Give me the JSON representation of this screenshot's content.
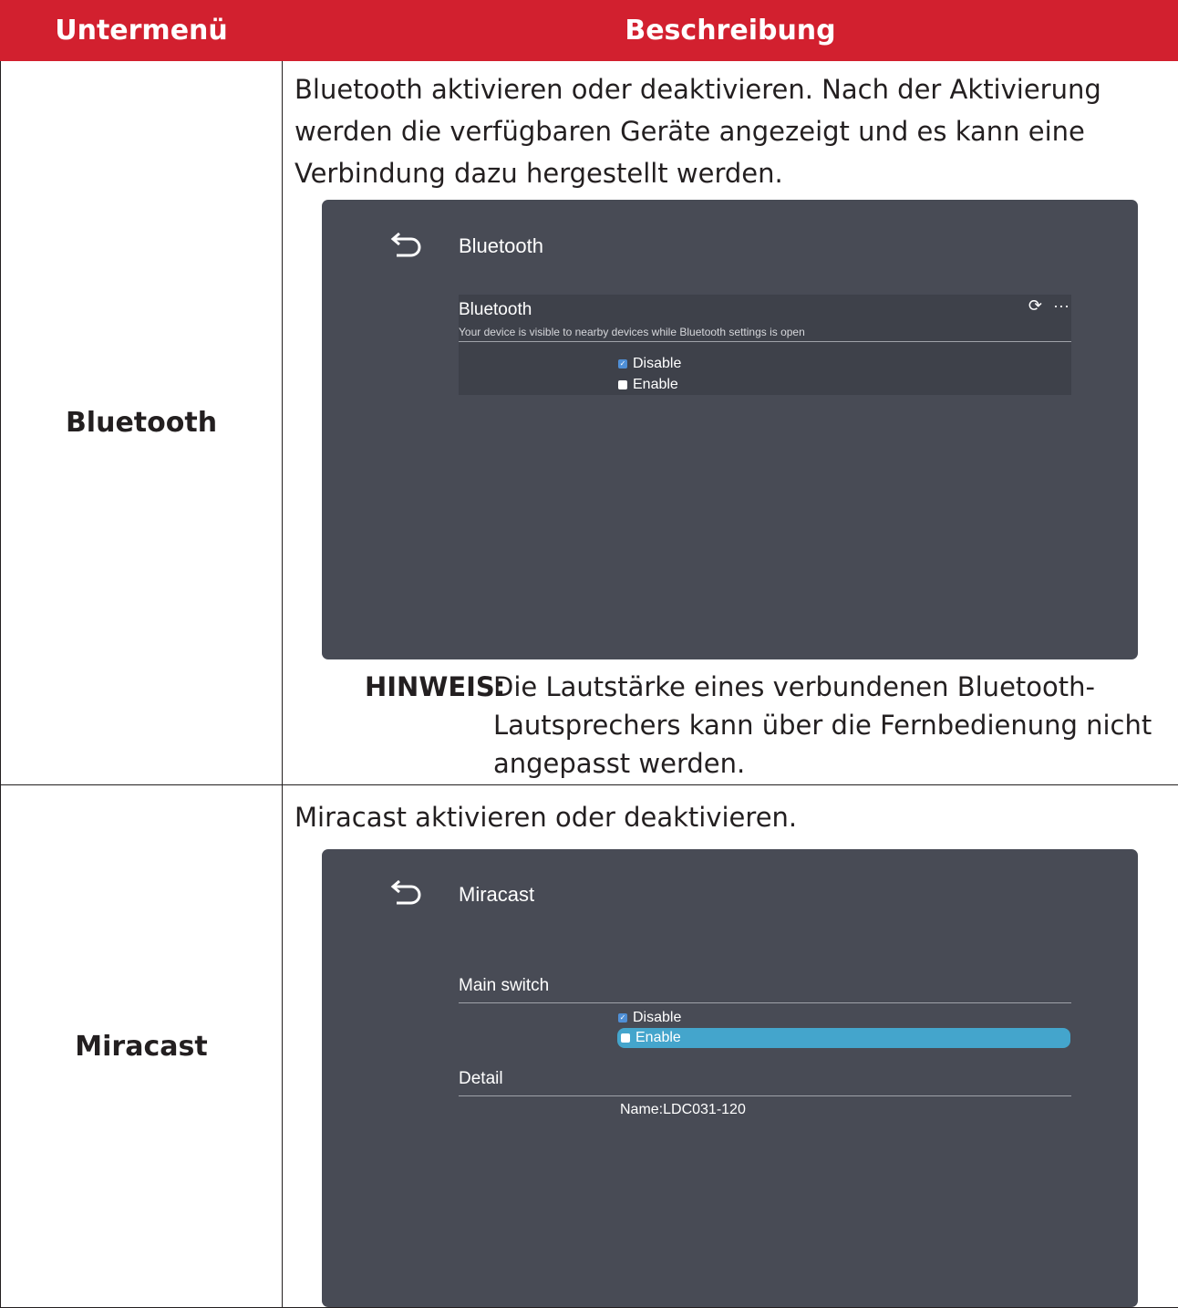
{
  "header": {
    "col1": "Untermenü",
    "col2": "Beschreibung"
  },
  "rows": [
    {
      "label": "Bluetooth",
      "description": "Bluetooth aktivieren oder deaktivieren. Nach der Aktivierung werden die verfügbaren Geräte angezeigt und es kann eine Verbindung dazu hergestellt werden.",
      "screen": {
        "title": "Bluetooth",
        "section_title": "Bluetooth",
        "section_subtitle": "Your device is visible to nearby devices while Bluetooth settings is open",
        "options": [
          "Disable",
          "Enable"
        ],
        "selected": "Disable",
        "icons": [
          "refresh-icon",
          "more-icon"
        ]
      },
      "note_label": "HINWEIS:",
      "note_text": "Die Lautstärke eines verbundenen Bluetooth-Lautsprechers kann über die Fernbedienung nicht angepasst werden."
    },
    {
      "label": "Miracast",
      "description": "Miracast aktivieren oder deaktivieren.",
      "screen": {
        "title": "Miracast",
        "main_switch_label": "Main switch",
        "options": [
          "Disable",
          "Enable"
        ],
        "selected": "Disable",
        "highlighted": "Enable",
        "detail_label": "Detail",
        "detail_value": "Name:LDC031-120"
      }
    }
  ],
  "colors": {
    "header_bg": "#d2202f",
    "screen_bg": "#484b55",
    "highlight": "#44a5cc"
  }
}
